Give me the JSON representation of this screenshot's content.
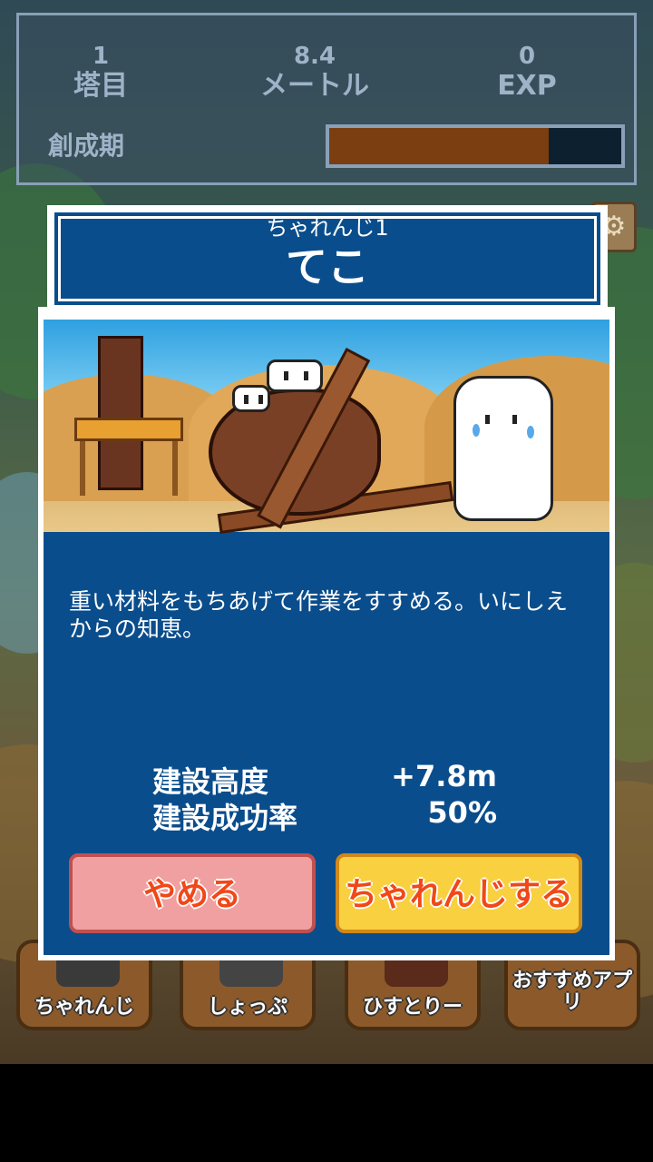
{
  "hud": {
    "floor": {
      "value": "1",
      "label": "塔目"
    },
    "height": {
      "value": "8.4",
      "label": "メートル"
    },
    "exp": {
      "value": "0",
      "label": "EXP"
    },
    "era_label": "創成期",
    "era_progress": 0.75
  },
  "dialog": {
    "subtitle": "ちゃれんじ1",
    "title": "てこ",
    "description": "重い材料をもちあげて作業をすすめる。いにしえからの知恵。",
    "stats": [
      {
        "label": "建設高度",
        "value": "+7.8m"
      },
      {
        "label": "建設成功率",
        "value": "50%"
      }
    ],
    "cancel_label": "やめる",
    "challenge_label": "ちゃれんじする"
  },
  "menu": [
    {
      "label": "ちゃれんじ",
      "icon": "cat-tower-icon"
    },
    {
      "label": "しょっぷ",
      "icon": "shop-cat-icon"
    },
    {
      "label": "ひすとりー",
      "icon": "history-book-icon"
    },
    {
      "label": "おすすめアプリ",
      "icon": "recommend-icon"
    }
  ],
  "colors": {
    "dialog_blue": "#0a4d8c",
    "cancel_button": "#f0a0a0",
    "challenge_button": "#f8d040",
    "button_text": "#f04818",
    "progress_fill": "#7a3e10"
  }
}
